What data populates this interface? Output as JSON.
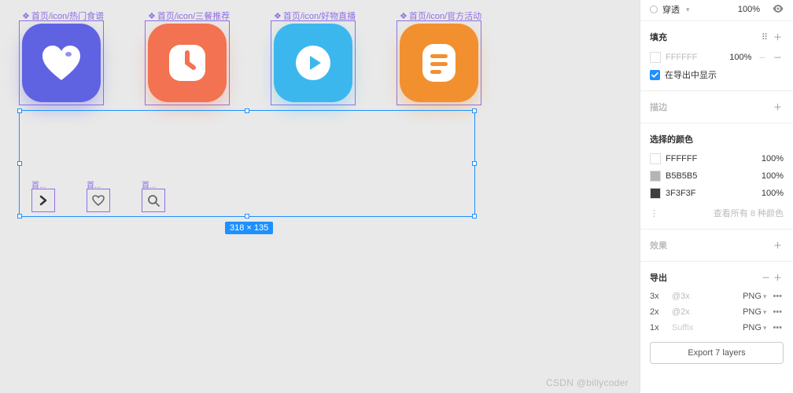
{
  "layers": [
    {
      "name": "首页/icon/热门食谱"
    },
    {
      "name": "首页/icon/三餐推荐"
    },
    {
      "name": "首页/icon/好物直播"
    },
    {
      "name": "首页/icon/官方活动"
    }
  ],
  "small_layers": [
    {
      "name": "首..."
    },
    {
      "name": "首..."
    },
    {
      "name": "首..."
    }
  ],
  "selection": {
    "dim": "318 × 135"
  },
  "panel": {
    "passthrough": {
      "label": "穿透",
      "value": "100%"
    },
    "fill": {
      "title": "填充",
      "color": "FFFFFF",
      "opacity": "100%",
      "show_label": "在导出中显示"
    },
    "stroke": {
      "title": "描边"
    },
    "selected_colors": {
      "title": "选择的颜色",
      "items": [
        {
          "hex": "FFFFFF",
          "pct": "100%",
          "sw": "#ffffff"
        },
        {
          "hex": "B5B5B5",
          "pct": "100%",
          "sw": "#b5b5b5"
        },
        {
          "hex": "3F3F3F",
          "pct": "100%",
          "sw": "#3f3f3f"
        }
      ],
      "more": "查看所有 8 种颜色"
    },
    "effects": {
      "title": "效果"
    },
    "export": {
      "title": "导出",
      "rows": [
        {
          "scale": "3x",
          "suffix": "@3x",
          "format": "PNG"
        },
        {
          "scale": "2x",
          "suffix": "@2x",
          "format": "PNG"
        },
        {
          "scale": "1x",
          "suffix": "Suffix",
          "format": "PNG"
        }
      ],
      "button": "Export 7 layers"
    }
  },
  "watermark": "CSDN @billycoder"
}
